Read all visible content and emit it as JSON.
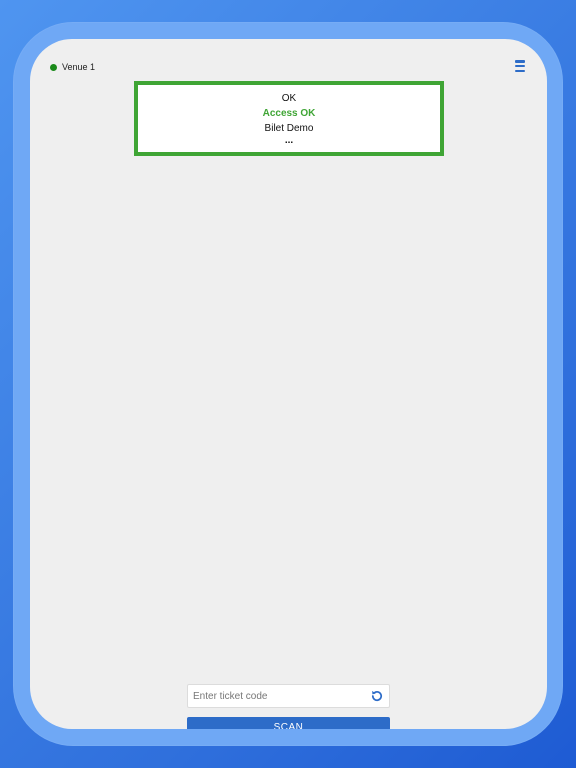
{
  "status": {
    "venue_label": "Venue 1",
    "online_color": "#1a8a1a"
  },
  "header": {
    "menu_icon": "hamburger-menu-icon"
  },
  "result": {
    "code": "OK",
    "status_text": "Access OK",
    "event_name": "Bilet Demo",
    "more": "...",
    "accent_color": "#3fa535"
  },
  "scanner": {
    "input_placeholder": "Enter ticket code",
    "input_value": "",
    "refresh_icon": "refresh-icon",
    "scan_label": "SCAN",
    "button_color": "#2d6cc8"
  }
}
